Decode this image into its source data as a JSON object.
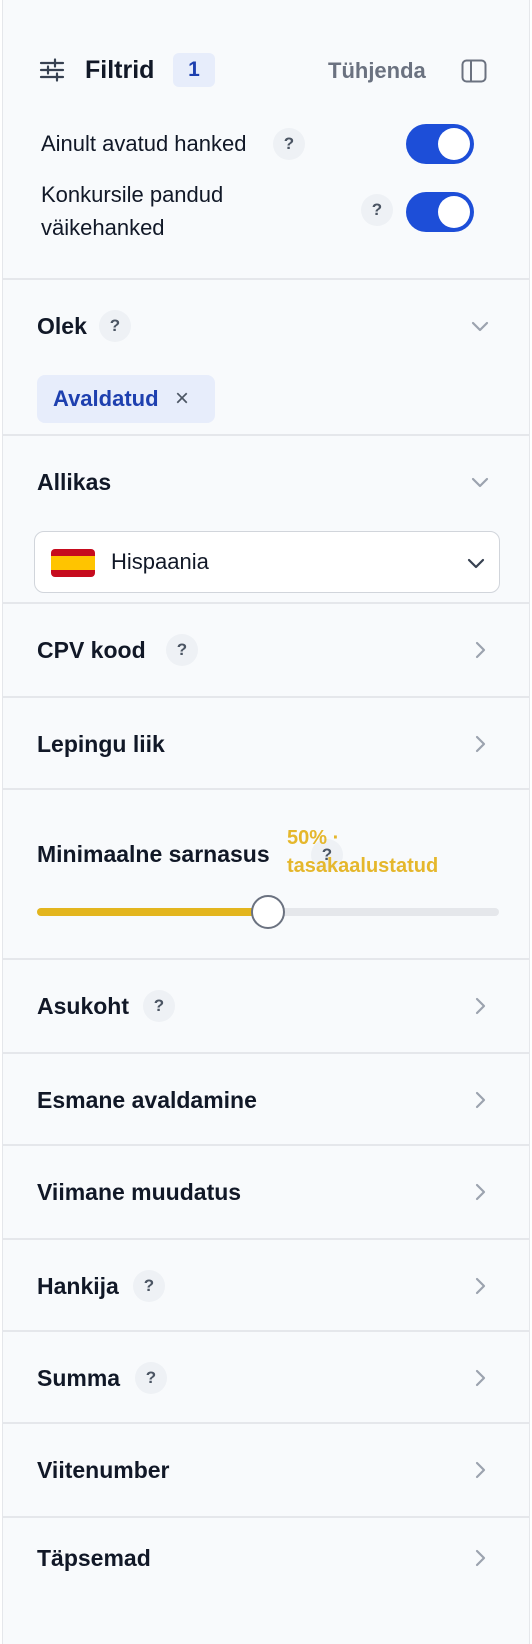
{
  "header": {
    "title": "Filtrid",
    "count": "1",
    "clear_label": "Tühjenda"
  },
  "toggles": [
    {
      "label": "Ainult avatud hanked",
      "help": "?",
      "on": true
    },
    {
      "label_line1": "Konkursile pandud",
      "label_line2": "väikehanked",
      "help": "?",
      "on": true
    }
  ],
  "status": {
    "title": "Olek",
    "help": "?",
    "chip_label": "Avaldatud",
    "chip_remove": "×"
  },
  "source": {
    "title": "Allikas",
    "selected": "Hispaania",
    "flag_icon": "spain-flag-icon"
  },
  "cpv": {
    "title": "CPV kood",
    "help": "?"
  },
  "contract_type": {
    "title": "Lepingu liik"
  },
  "similarity": {
    "title": "Minimaalne sarnasus",
    "help": "?",
    "value_label_line1": "50% ·",
    "value_label_line2": "tasakaalustatud",
    "value": 50
  },
  "location": {
    "title": "Asukoht",
    "help": "?"
  },
  "first_published": {
    "title": "Esmane avaldamine"
  },
  "last_modified": {
    "title": "Viimane muudatus"
  },
  "buyer": {
    "title": "Hankija",
    "help": "?"
  },
  "amount": {
    "title": "Summa",
    "help": "?"
  },
  "reference": {
    "title": "Viitenumber"
  },
  "advanced": {
    "title": "Täpsemad"
  },
  "colors": {
    "accent": "#1d4ed8",
    "slider": "#e3b51e",
    "badge_bg": "#e7edfb"
  }
}
